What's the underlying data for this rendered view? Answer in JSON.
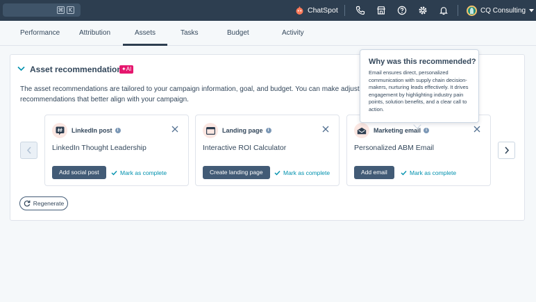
{
  "topbar": {
    "search_shortcut_keys": [
      "⌘",
      "K"
    ],
    "chatspot_label": "ChatSpot",
    "account_name": "CQ Consulting",
    "colors": {
      "background": "#2d3e50",
      "search": "#3f5469"
    }
  },
  "tabs": [
    {
      "label": "Performance"
    },
    {
      "label": "Attribution"
    },
    {
      "label": "Assets",
      "active": true
    },
    {
      "label": "Tasks"
    },
    {
      "label": "Budget"
    },
    {
      "label": "Activity"
    }
  ],
  "section": {
    "title": "Asset recommendations",
    "ai_badge": "✦AI",
    "description": "The asset recommendations are tailored to your campaign information, goal, and budget. You can make adjustments at any time to generate new recommendations that better align with your campaign."
  },
  "tiles": [
    {
      "type": "LinkedIn post",
      "icon": "hashtag-icon",
      "name": "LinkedIn Thought Leadership",
      "action": "Add social post",
      "mark": "Mark as complete"
    },
    {
      "type": "Landing page",
      "icon": "browser-window-icon",
      "name": "Interactive ROI Calculator",
      "action": "Create landing page",
      "mark": "Mark as complete"
    },
    {
      "type": "Marketing email",
      "icon": "envelope-icon",
      "name": "Personalized ABM Email",
      "action": "Add email",
      "mark": "Mark as complete"
    }
  ],
  "regenerate_label": "Regenerate",
  "tooltip": {
    "title": "Why was this recommended?",
    "body": "Email ensures direct, personalized communication with supply chain decision-makers, nurturing leads effectively. It drives engagement by highlighting industry pain points, solution benefits, and a clear call to action."
  },
  "colors": {
    "primary_button": "#425b76",
    "link": "#0091ae",
    "ai_badge": "#e5176e",
    "text": "#33475b"
  }
}
